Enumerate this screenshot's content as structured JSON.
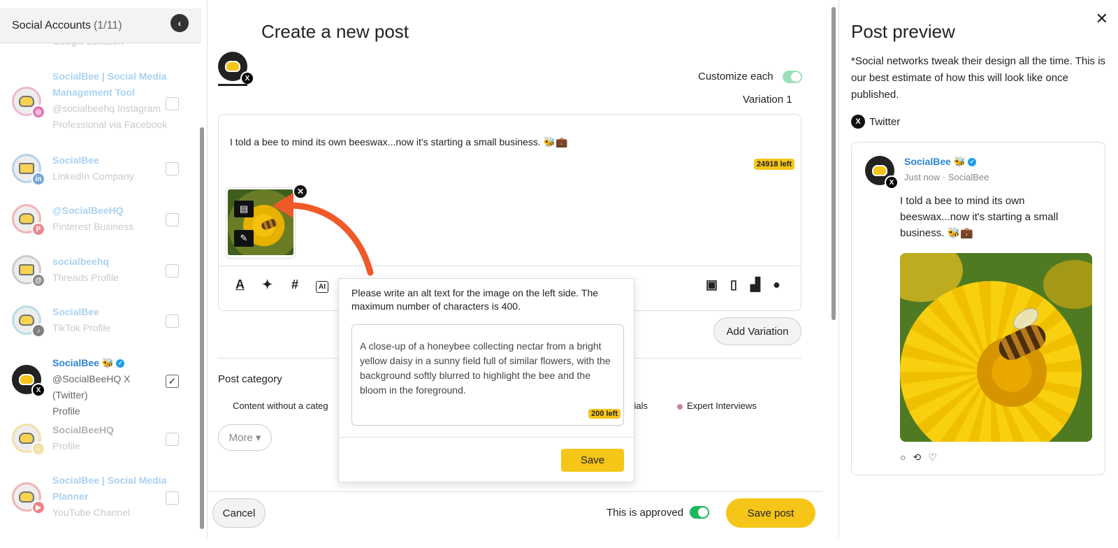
{
  "left_panel": {
    "title": "Social Accounts",
    "count": "(1/11)",
    "partial_top": "Google Location",
    "accounts": [
      {
        "name_lines": [
          "SocialBee | Social Media",
          "Management Tool"
        ],
        "sub_lines": [
          "@socialbeehq Instagram",
          "Professional via Facebook"
        ],
        "network": "instagram",
        "checked": false
      },
      {
        "name_lines": [
          "SocialBee"
        ],
        "sub_lines": [
          "LinkedIn Company"
        ],
        "network": "linkedin",
        "checked": false
      },
      {
        "name_lines": [
          "@SocialBeeHQ"
        ],
        "sub_lines": [
          "Pinterest Business"
        ],
        "network": "pinterest",
        "checked": false
      },
      {
        "name_lines": [
          "socialbeehq"
        ],
        "sub_lines": [
          "Threads Profile"
        ],
        "network": "threads",
        "checked": false
      },
      {
        "name_lines": [
          "SocialBee"
        ],
        "sub_lines": [
          "TikTok Profile"
        ],
        "network": "tiktok",
        "checked": false
      },
      {
        "name_lines": [
          "SocialBee 🐝"
        ],
        "sub_lines": [
          "@SocialBeeHQ X (Twitter)",
          "Profile"
        ],
        "network": "x",
        "checked": true
      },
      {
        "name_lines": [
          "SocialBeeHQ"
        ],
        "sub_lines": [
          "Profile"
        ],
        "network": "other",
        "checked": false
      },
      {
        "name_lines": [
          "SocialBee | Social Media",
          "Planner"
        ],
        "sub_lines": [
          "YouTube Channel"
        ],
        "network": "youtube",
        "checked": false
      }
    ]
  },
  "center": {
    "title": "Create a new post",
    "customize_label": "Customize each",
    "variation_label": "Variation 1",
    "post_text": "I told a bee to mind its own beeswax...now it's starting a small business. 🐝💼",
    "chars_left": "24918 left",
    "add_variation": "Add Variation",
    "category_label": "Post category",
    "categories": [
      {
        "label": "Content without a categ",
        "color": ""
      },
      {
        "label": "onials",
        "color": ""
      },
      {
        "label": "Expert Interviews",
        "color": "#c08a8f"
      }
    ],
    "more_label": "More",
    "cancel_label": "Cancel",
    "approved_label": "This is approved",
    "save_post_label": "Save post"
  },
  "alt_popup": {
    "instruction": "Please write an alt text for the image on the left side. The maximum number of characters is 400.",
    "alt_text": "A close-up of a honeybee collecting nectar from a bright yellow daisy in a sunny field full of similar flowers, with the background softly blurred to highlight the bee and the bloom in the foreground.",
    "chars_left": "200 left",
    "save_label": "Save"
  },
  "preview": {
    "title": "Post preview",
    "note": "*Social networks tweak their design all the time. This is our best estimate of how this will look like once published.",
    "network_label": "Twitter",
    "card_name": "SocialBee 🐝",
    "card_meta": "Just now · SocialBee",
    "card_text": "I told a bee to mind its own beeswax...now it's starting a small business. 🐝💼"
  },
  "colors": {
    "accent_yellow": "#f5c518",
    "link_blue": "#2c86d6",
    "toggle_green": "#1cb85c",
    "arrow_orange": "#f05a28"
  }
}
